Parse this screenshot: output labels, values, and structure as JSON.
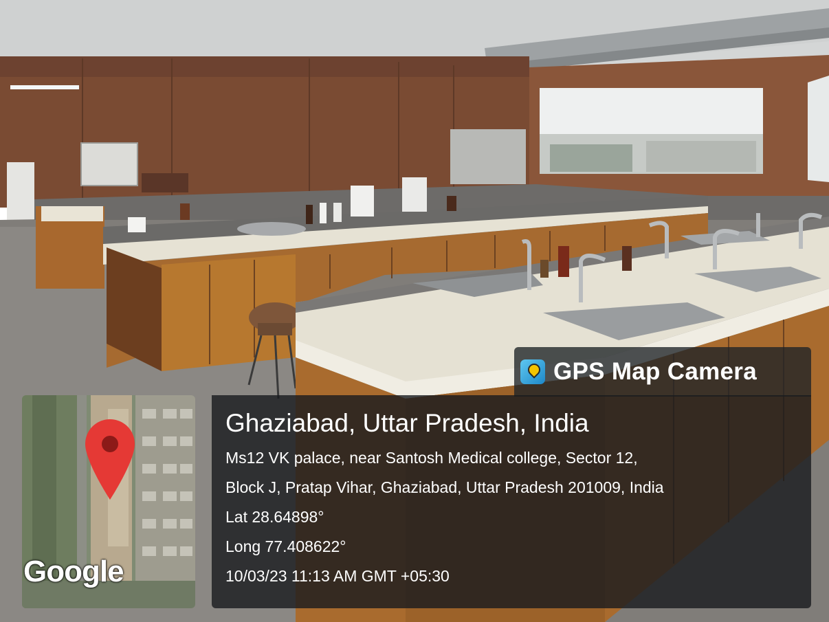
{
  "overlay": {
    "app_name": "GPS Map Camera",
    "city": "Ghaziabad, Uttar Pradesh, India",
    "address_line1": "Ms12 VK palace, near Santosh Medical college, Sector 12,",
    "address_line2": "Block J, Pratap Vihar, Ghaziabad, Uttar Pradesh 201009, India",
    "latitude": "Lat 28.64898°",
    "longitude": "Long 77.408622°",
    "timestamp": "10/03/23 11:13 AM GMT +05:30",
    "map_provider": "Google"
  },
  "photo": {
    "subject": "laboratory"
  }
}
